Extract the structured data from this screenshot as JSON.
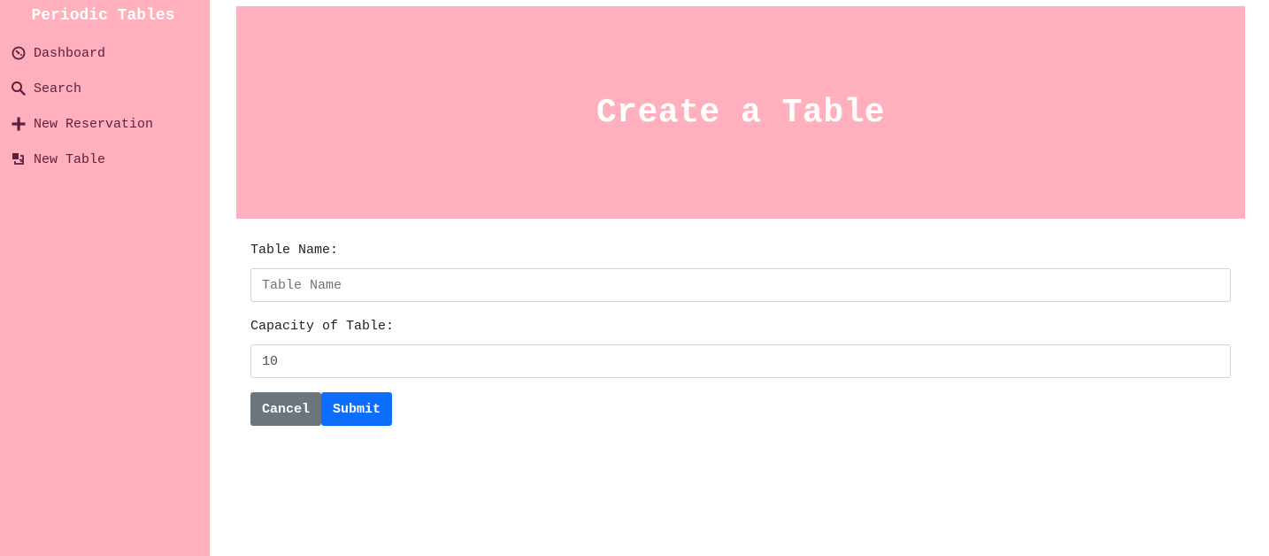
{
  "app": {
    "brand": "Periodic Tables"
  },
  "sidebar": {
    "items": [
      {
        "label": "Dashboard",
        "icon": "dashboard-icon"
      },
      {
        "label": "Search",
        "icon": "search-icon"
      },
      {
        "label": "New Reservation",
        "icon": "plus-icon"
      },
      {
        "label": "New Table",
        "icon": "layers-icon"
      }
    ]
  },
  "hero": {
    "title": "Create a Table"
  },
  "form": {
    "table_name_label": "Table Name:",
    "table_name_placeholder": "Table Name",
    "table_name_value": "",
    "capacity_label": "Capacity of Table:",
    "capacity_value": "10",
    "cancel_label": "Cancel",
    "submit_label": "Submit"
  },
  "colors": {
    "sidebar_bg": "#ffb0bc",
    "nav_text": "#5b1f3f",
    "cancel_button": "#6c757d",
    "submit_button": "#0d6efd"
  }
}
